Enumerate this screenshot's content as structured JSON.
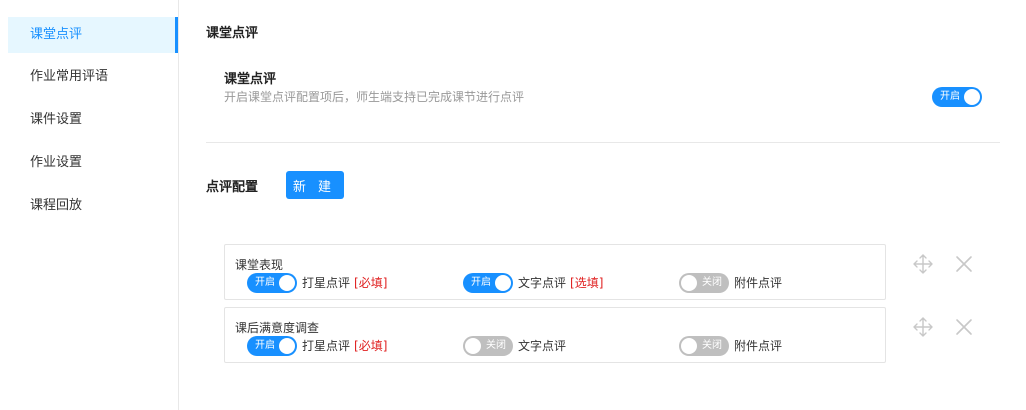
{
  "sidebar": {
    "items": [
      {
        "label": "课堂点评",
        "active": true
      },
      {
        "label": "作业常用评语",
        "active": false
      },
      {
        "label": "课件设置",
        "active": false
      },
      {
        "label": "作业设置",
        "active": false
      },
      {
        "label": "课程回放",
        "active": false
      }
    ]
  },
  "main": {
    "section_title": "课堂点评",
    "feature": {
      "title": "课堂点评",
      "description": "开启课堂点评配置项后，师生端支持已完成课节进行点评",
      "toggle_label": "开启",
      "enabled": true
    },
    "config_label": "点评配置",
    "new_button": "新 建",
    "cards": [
      {
        "title": "课堂表现",
        "options": [
          {
            "toggle_label": "开启",
            "on": true,
            "label": "打星点评",
            "tag": "[必填]"
          },
          {
            "toggle_label": "开启",
            "on": true,
            "label": "文字点评",
            "tag": "[选填]"
          },
          {
            "toggle_label": "关闭",
            "on": false,
            "label": "附件点评",
            "tag": ""
          }
        ]
      },
      {
        "title": "课后满意度调查",
        "options": [
          {
            "toggle_label": "开启",
            "on": true,
            "label": "打星点评",
            "tag": "[必填]"
          },
          {
            "toggle_label": "关闭",
            "on": false,
            "label": "文字点评",
            "tag": ""
          },
          {
            "toggle_label": "关闭",
            "on": false,
            "label": "附件点评",
            "tag": ""
          }
        ]
      }
    ],
    "icons": {
      "move": "move-icon",
      "delete": "close-icon"
    }
  },
  "colors": {
    "accent": "#1890ff",
    "required": "#e02020",
    "muted": "#999999",
    "toggle_off": "#bfbfbf"
  }
}
